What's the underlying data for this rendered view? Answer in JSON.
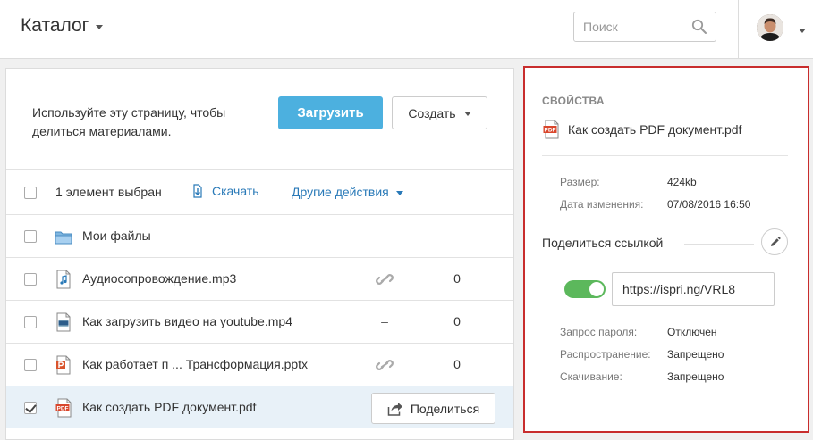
{
  "header": {
    "title": "Каталог",
    "search_placeholder": "Поиск"
  },
  "left": {
    "intro": "Используйте эту страницу, чтобы делиться материалами.",
    "upload_label": "Загрузить",
    "create_label": "Создать",
    "toolbar": {
      "selected_text": "1 элемент выбран",
      "download_label": "Скачать",
      "more_label": "Другие действия"
    },
    "files": [
      {
        "name": "Мои файлы",
        "type": "folder",
        "link": "–",
        "count": "–",
        "checked": false
      },
      {
        "name": "Аудиосопровождение.mp3",
        "type": "audio",
        "link": "link-icon",
        "count": "0",
        "checked": false
      },
      {
        "name": "Как загрузить видео на youtube.mp4",
        "type": "video",
        "link": "–",
        "count": "0",
        "checked": false
      },
      {
        "name": "Как работает п ... Трансформация.pptx",
        "type": "pptx",
        "link": "link-icon",
        "count": "0",
        "checked": false
      },
      {
        "name": "Как создать PDF документ.pdf",
        "type": "pdf",
        "share_label": "Поделиться",
        "checked": true
      }
    ]
  },
  "props": {
    "title": "СВОЙСТВА",
    "file_name": "Как создать PDF документ.pdf",
    "size_label": "Размер:",
    "size_value": "424kb",
    "modified_label": "Дата изменения:",
    "modified_value": "07/08/2016 16:50",
    "share_title": "Поделиться ссылкой",
    "share_enabled": true,
    "share_url": "https://ispri.ng/VRL8",
    "password_label": "Запрос пароля:",
    "password_value": "Отключен",
    "distribution_label": "Распространение:",
    "distribution_value": "Запрещено",
    "download_label": "Скачивание:",
    "download_value": "Запрещено"
  },
  "colors": {
    "accent": "#4cb0df",
    "link": "#2a7ab8",
    "toggle_on": "#5cb85c",
    "highlight_border": "#c82d2d",
    "selected_row": "#e8f1f8"
  }
}
